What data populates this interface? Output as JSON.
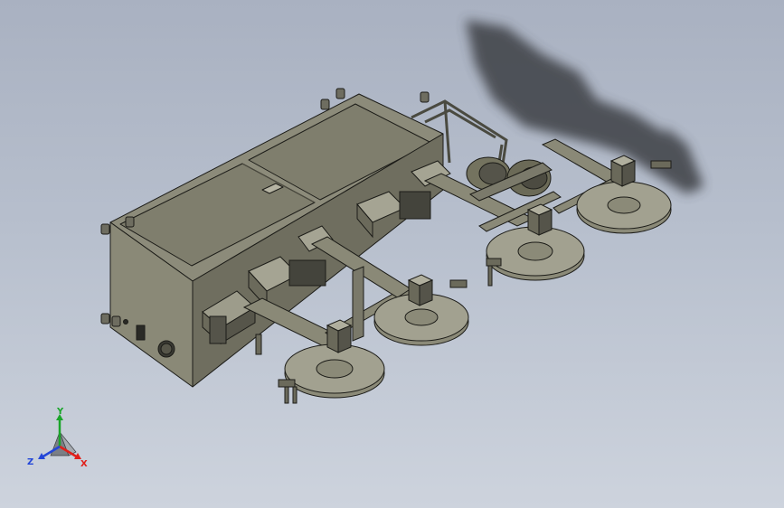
{
  "triad": {
    "x_label": "X",
    "y_label": "Y",
    "z_label": "Z",
    "x_color": "#e0201a",
    "y_color": "#1aa52a",
    "z_color": "#2346d8"
  },
  "colors": {
    "background_top": "#a9b1c1",
    "background_bottom": "#cdd3dd",
    "machine_body": "#8c8b79",
    "machine_dark": "#5b5a4e",
    "edge_line": "#1c1c18"
  },
  "scene": {
    "model": "cabinet-with-four-brush-disc-arms"
  }
}
